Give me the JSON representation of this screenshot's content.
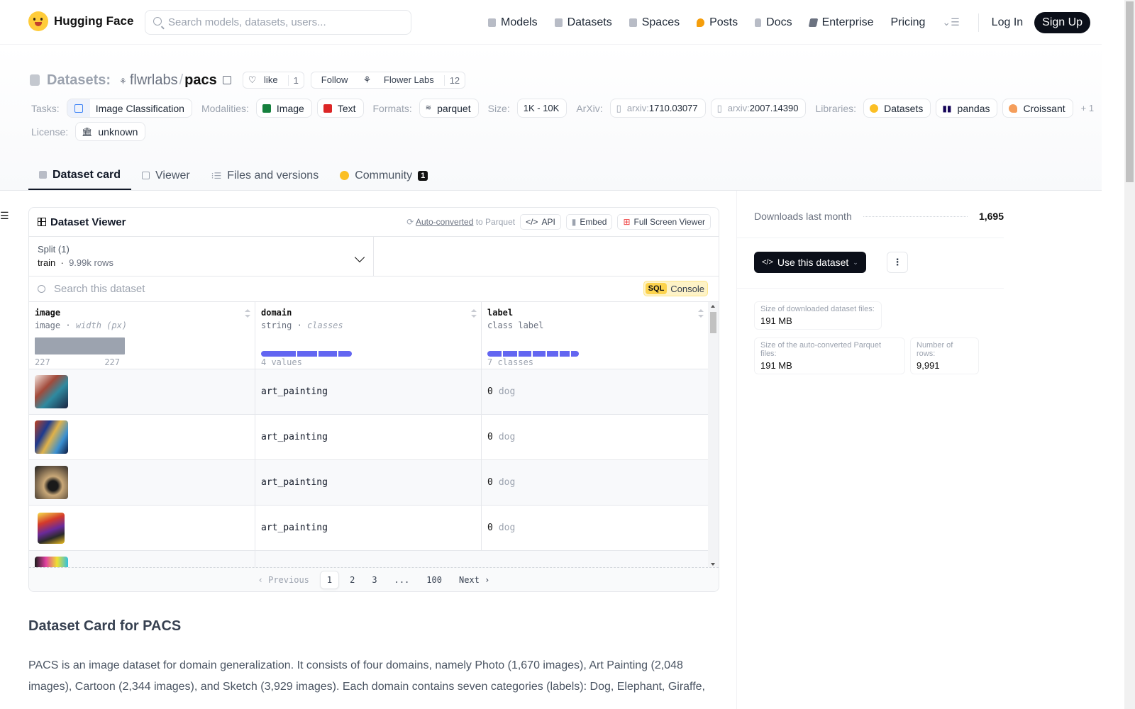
{
  "nav": {
    "brand": "Hugging Face",
    "search_placeholder": "Search models, datasets, users...",
    "links": [
      {
        "label": "Models",
        "icon": "cube-icon"
      },
      {
        "label": "Datasets",
        "icon": "database-icon"
      },
      {
        "label": "Spaces",
        "icon": "grid-icon"
      },
      {
        "label": "Posts",
        "icon": "speech-bubble-icon"
      },
      {
        "label": "Docs",
        "icon": "doc-icon"
      },
      {
        "label": "Enterprise",
        "icon": "enterprise-icon"
      },
      {
        "label": "Pricing",
        "icon": ""
      }
    ],
    "login": "Log In",
    "signup": "Sign Up"
  },
  "header": {
    "section": "Datasets:",
    "org": "flwrlabs",
    "repo": "pacs",
    "like_label": "like",
    "like_count": "1",
    "follow_label": "Follow",
    "follow_org": "Flower Labs",
    "follow_count": "12",
    "tags": {
      "tasks_label": "Tasks:",
      "task": "Image Classification",
      "modalities_label": "Modalities:",
      "modalities": [
        "Image",
        "Text"
      ],
      "formats_label": "Formats:",
      "format": "parquet",
      "size_label": "Size:",
      "size": "1K - 10K",
      "arxiv_label": "ArXiv:",
      "arxiv": [
        {
          "prefix": "arxiv:",
          "id": "1710.03077"
        },
        {
          "prefix": "arxiv:",
          "id": "2007.14390"
        }
      ],
      "libraries_label": "Libraries:",
      "libraries": [
        "Datasets",
        "pandas",
        "Croissant"
      ],
      "libraries_more": "+ 1",
      "license_label": "License:",
      "license": "unknown"
    }
  },
  "tabs": [
    {
      "label": "Dataset card",
      "active": true
    },
    {
      "label": "Viewer"
    },
    {
      "label": "Files and versions"
    },
    {
      "label": "Community",
      "badge": "1"
    }
  ],
  "viewer": {
    "title": "Dataset Viewer",
    "auto_converted": "Auto-converted",
    "to_parquet": " to Parquet",
    "api": "API",
    "embed": "Embed",
    "fullscreen": "Full Screen Viewer",
    "split_label": "Split (1)",
    "split_name": "train",
    "split_rows": "9.99k rows",
    "search_placeholder": "Search this dataset",
    "sql_tag": "SQL",
    "sql_label": "Console",
    "columns": [
      {
        "name": "image",
        "type": "image",
        "stat": "width (px)",
        "foot_min": "227",
        "foot_max": "227"
      },
      {
        "name": "domain",
        "type": "string",
        "stat": "classes",
        "foot": "4 values"
      },
      {
        "name": "label",
        "type": "class label",
        "stat": "",
        "foot": "7 classes"
      }
    ],
    "rows": [
      {
        "domain": "art_painting",
        "label_id": "0",
        "label_name": "dog"
      },
      {
        "domain": "art_painting",
        "label_id": "0",
        "label_name": "dog"
      },
      {
        "domain": "art_painting",
        "label_id": "0",
        "label_name": "dog"
      },
      {
        "domain": "art_painting",
        "label_id": "0",
        "label_name": "dog"
      },
      {
        "domain": "",
        "label_id": "",
        "label_name": ""
      }
    ],
    "pagination": {
      "previous": "Previous",
      "pages": [
        "1",
        "2",
        "3",
        "...",
        "100"
      ],
      "current": "1",
      "next": "Next"
    }
  },
  "card": {
    "heading": "Dataset Card for PACS",
    "paragraph": "PACS is an image dataset for domain generalization. It consists of four domains, namely Photo (1,670 images), Art Painting (2,048 images), Cartoon (2,344 images), and Sketch (3,929 images). Each domain contains seven categories (labels): Dog, Elephant, Giraffe,"
  },
  "sidebar": {
    "downloads_label": "Downloads last month",
    "downloads_value": "1,695",
    "use_button": "Use this dataset",
    "stats": [
      {
        "key": "Size of downloaded dataset files:",
        "value": "191 MB"
      },
      {
        "key": "Size of the auto-converted Parquet files:",
        "value": "191 MB"
      },
      {
        "key": "Number of rows:",
        "value": "9,991"
      }
    ]
  }
}
